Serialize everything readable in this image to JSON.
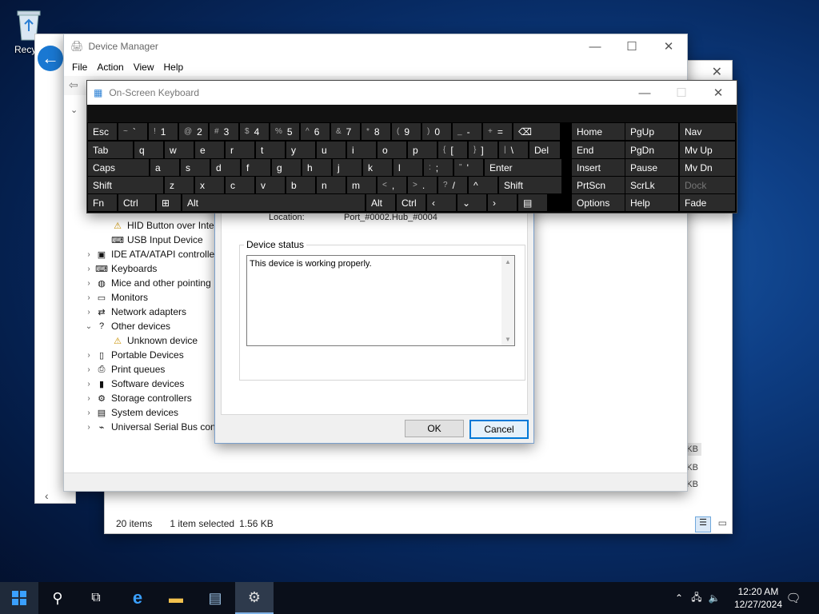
{
  "desktop": {
    "recycle_label": "Recycl"
  },
  "explorer": {
    "status_items": "20 items",
    "status_selected": "1 item selected",
    "status_size": "1.56 KB",
    "kb_labels": [
      "KB",
      "KB",
      "KB"
    ]
  },
  "device_manager": {
    "title": "Device Manager",
    "menu": [
      "File",
      "Action",
      "View",
      "Help"
    ],
    "tree": [
      {
        "label": "HID Button over Inte",
        "indent": 2,
        "chev": "",
        "icon": "hid-device-icon"
      },
      {
        "label": "USB Input Device",
        "indent": 2,
        "chev": "",
        "icon": "usb-input-icon"
      },
      {
        "label": "IDE ATA/ATAPI controlle",
        "indent": 1,
        "chev": "›",
        "icon": "ide-controller-icon"
      },
      {
        "label": "Keyboards",
        "indent": 1,
        "chev": "›",
        "icon": "keyboard-icon"
      },
      {
        "label": "Mice and other pointing",
        "indent": 1,
        "chev": "›",
        "icon": "mouse-icon"
      },
      {
        "label": "Monitors",
        "indent": 1,
        "chev": "›",
        "icon": "monitor-icon"
      },
      {
        "label": "Network adapters",
        "indent": 1,
        "chev": "›",
        "icon": "network-adapter-icon"
      },
      {
        "label": "Other devices",
        "indent": 1,
        "chev": "⌄",
        "icon": "other-devices-icon"
      },
      {
        "label": "Unknown device",
        "indent": 2,
        "chev": "",
        "icon": "unknown-device-warning-icon"
      },
      {
        "label": "Portable Devices",
        "indent": 1,
        "chev": "›",
        "icon": "portable-device-icon"
      },
      {
        "label": "Print queues",
        "indent": 1,
        "chev": "›",
        "icon": "printer-icon"
      },
      {
        "label": "Software devices",
        "indent": 1,
        "chev": "›",
        "icon": "software-device-icon"
      },
      {
        "label": "Storage controllers",
        "indent": 1,
        "chev": "›",
        "icon": "storage-controller-icon"
      },
      {
        "label": "System devices",
        "indent": 1,
        "chev": "›",
        "icon": "system-device-icon"
      },
      {
        "label": "Universal Serial Bus con",
        "indent": 1,
        "chev": "›",
        "icon": "usb-controller-icon"
      }
    ]
  },
  "properties": {
    "location_label": "Location:",
    "location_value": "Port_#0002.Hub_#0004",
    "device_status_label": "Device status",
    "status_text": "This device is working properly.",
    "ok_label": "OK",
    "cancel_label": "Cancel"
  },
  "osk": {
    "title": "On-Screen Keyboard",
    "rows": [
      [
        {
          "label": "Esc",
          "w": 38
        },
        {
          "sh": "~",
          "label": "`",
          "w": 38
        },
        {
          "sh": "!",
          "label": "1",
          "w": 38
        },
        {
          "sh": "@",
          "label": "2",
          "w": 38
        },
        {
          "sh": "#",
          "label": "3",
          "w": 38
        },
        {
          "sh": "$",
          "label": "4",
          "w": 38
        },
        {
          "sh": "%",
          "label": "5",
          "w": 38
        },
        {
          "sh": "^",
          "label": "6",
          "w": 38
        },
        {
          "sh": "&",
          "label": "7",
          "w": 38
        },
        {
          "sh": "*",
          "label": "8",
          "w": 38
        },
        {
          "sh": "(",
          "label": "9",
          "w": 38
        },
        {
          "sh": ")",
          "label": "0",
          "w": 38
        },
        {
          "sh": "_",
          "label": "-",
          "w": 38
        },
        {
          "sh": "+",
          "label": "=",
          "w": 38
        },
        {
          "label": "⌫",
          "w": 60
        }
      ],
      [
        {
          "label": "Tab",
          "w": 58
        },
        {
          "label": "q",
          "w": 38
        },
        {
          "label": "w",
          "w": 38
        },
        {
          "label": "e",
          "w": 38
        },
        {
          "label": "r",
          "w": 38
        },
        {
          "label": "t",
          "w": 38
        },
        {
          "label": "y",
          "w": 38
        },
        {
          "label": "u",
          "w": 38
        },
        {
          "label": "i",
          "w": 38
        },
        {
          "label": "o",
          "w": 38
        },
        {
          "label": "p",
          "w": 38
        },
        {
          "sh": "{",
          "label": "[",
          "w": 38
        },
        {
          "sh": "}",
          "label": "]",
          "w": 38
        },
        {
          "sh": "|",
          "label": "\\",
          "w": 38
        },
        {
          "label": "Del",
          "w": 40
        }
      ],
      [
        {
          "label": "Caps",
          "w": 78
        },
        {
          "label": "a",
          "w": 38
        },
        {
          "label": "s",
          "w": 38
        },
        {
          "label": "d",
          "w": 38
        },
        {
          "label": "f",
          "w": 38
        },
        {
          "label": "g",
          "w": 38
        },
        {
          "label": "h",
          "w": 38
        },
        {
          "label": "j",
          "w": 38
        },
        {
          "label": "k",
          "w": 38
        },
        {
          "label": "l",
          "w": 38
        },
        {
          "sh": ":",
          "label": ";",
          "w": 38
        },
        {
          "sh": "\"",
          "label": "'",
          "w": 38
        },
        {
          "label": "Enter",
          "w": 98
        }
      ],
      [
        {
          "label": "Shift",
          "w": 96
        },
        {
          "label": "z",
          "w": 38
        },
        {
          "label": "x",
          "w": 38
        },
        {
          "label": "c",
          "w": 38
        },
        {
          "label": "v",
          "w": 38
        },
        {
          "label": "b",
          "w": 38
        },
        {
          "label": "n",
          "w": 38
        },
        {
          "label": "m",
          "w": 38
        },
        {
          "sh": "<",
          "label": ",",
          "w": 38
        },
        {
          "sh": ">",
          "label": ".",
          "w": 38
        },
        {
          "sh": "?",
          "label": "/",
          "w": 38
        },
        {
          "label": "^",
          "w": 38
        },
        {
          "label": "Shift",
          "w": 80
        }
      ],
      [
        {
          "label": "Fn",
          "w": 38
        },
        {
          "label": "Ctrl",
          "w": 48
        },
        {
          "label": "⊞",
          "w": 32
        },
        {
          "label": "Alt",
          "w": 230
        },
        {
          "label": "Alt",
          "w": 38
        },
        {
          "label": "Ctrl",
          "w": 38
        },
        {
          "label": "‹",
          "w": 38
        },
        {
          "label": "⌄",
          "w": 38
        },
        {
          "label": "›",
          "w": 38
        },
        {
          "label": "▤",
          "w": 38
        }
      ]
    ],
    "nav_rows": [
      [
        "Home",
        "PgUp",
        "Nav"
      ],
      [
        "End",
        "PgDn",
        "Mv Up"
      ],
      [
        "Insert",
        "Pause",
        "Mv Dn"
      ],
      [
        "PrtScn",
        "ScrLk",
        "Dock"
      ],
      [
        "Options",
        "Help",
        "Fade"
      ]
    ]
  },
  "taskbar": {
    "time": "12:20 AM",
    "date": "12/27/2024"
  }
}
